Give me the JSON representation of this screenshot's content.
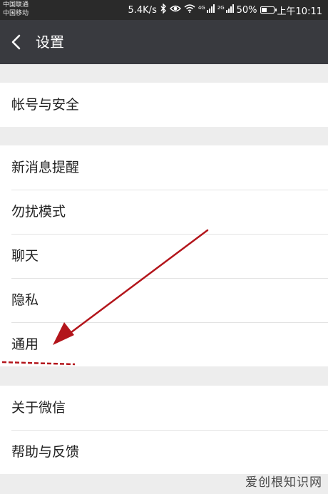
{
  "status_bar": {
    "carrier_1": "中国联通",
    "carrier_2": "中国移动",
    "net_speed": "5.4K/s",
    "sim1_tag": "4G",
    "sim2_tag": "2G",
    "battery": "50%",
    "battery_level": 0.5,
    "time": "上午10:11"
  },
  "title_bar": {
    "back_icon": "chevron-left-icon",
    "title": "设置"
  },
  "groups": [
    {
      "items": [
        {
          "label": "帐号与安全"
        }
      ]
    },
    {
      "items": [
        {
          "label": "新消息提醒"
        },
        {
          "label": "勿扰模式"
        },
        {
          "label": "聊天"
        },
        {
          "label": "隐私"
        },
        {
          "label": "通用"
        }
      ]
    },
    {
      "items": [
        {
          "label": "关于微信"
        },
        {
          "label": "帮助与反馈"
        }
      ]
    }
  ],
  "annotation": {
    "arrow_color": "#b3151b",
    "underline_color": "#b3151b"
  },
  "watermark": {
    "text_cn": "爱创根知识网"
  },
  "colors": {
    "titlebar_bg": "#393a3f",
    "statusbar_bg": "#2a2a2a",
    "page_bg": "#ededed"
  }
}
